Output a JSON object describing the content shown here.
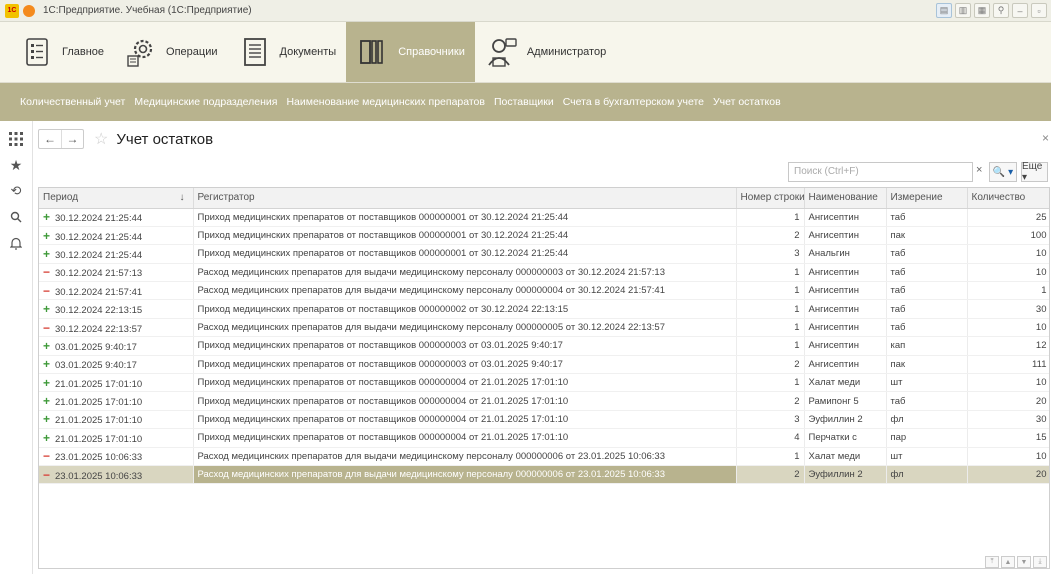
{
  "window": {
    "title": "1С:Предприятие. Учебная (1С:Предприятие)",
    "logo_text": "1С"
  },
  "sections": [
    {
      "label": "Главное",
      "icon": "main-icon"
    },
    {
      "label": "Операции",
      "icon": "operations-icon"
    },
    {
      "label": "Документы",
      "icon": "documents-icon"
    },
    {
      "label": "Справочники",
      "icon": "catalogs-icon",
      "active": true
    },
    {
      "label": "Администратор",
      "icon": "admin-icon"
    }
  ],
  "nav_items": [
    "Количественный учет",
    "Медицинские подразделения",
    "Наименование медицинских препаратов",
    "Поставщики",
    "Счета в бухгалтерском учете",
    "Учет остатков"
  ],
  "form": {
    "title": "Учет остатков",
    "search_placeholder": "Поиск (Ctrl+F)",
    "more_label": "Еще ▾",
    "search_btn_label": "🔍 ▾"
  },
  "table": {
    "columns": [
      "Период",
      "Регистратор",
      "Номер строки",
      "Наименование",
      "Измерение",
      "Количество"
    ],
    "rows": [
      {
        "sign": "+",
        "period": "30.12.2024 21:25:44",
        "registrar": "Приход медицинских препаратов от поставщиков 000000001 от 30.12.2024 21:25:44",
        "line": "1",
        "name": "Ангисептин",
        "unit": "таб",
        "qty": "25"
      },
      {
        "sign": "+",
        "period": "30.12.2024 21:25:44",
        "registrar": "Приход медицинских препаратов от поставщиков 000000001 от 30.12.2024 21:25:44",
        "line": "2",
        "name": "Ангисептин",
        "unit": "пак",
        "qty": "100"
      },
      {
        "sign": "+",
        "period": "30.12.2024 21:25:44",
        "registrar": "Приход медицинских препаратов от поставщиков 000000001 от 30.12.2024 21:25:44",
        "line": "3",
        "name": "Анальгин",
        "unit": "таб",
        "qty": "10"
      },
      {
        "sign": "−",
        "period": "30.12.2024 21:57:13",
        "registrar": "Расход медицинских препаратов для выдачи медицинскому персоналу 000000003 от 30.12.2024 21:57:13",
        "line": "1",
        "name": "Ангисептин",
        "unit": "таб",
        "qty": "10"
      },
      {
        "sign": "−",
        "period": "30.12.2024 21:57:41",
        "registrar": "Расход медицинских препаратов для выдачи медицинскому персоналу 000000004 от 30.12.2024 21:57:41",
        "line": "1",
        "name": "Ангисептин",
        "unit": "таб",
        "qty": "1"
      },
      {
        "sign": "+",
        "period": "30.12.2024 22:13:15",
        "registrar": "Приход медицинских препаратов от поставщиков 000000002 от 30.12.2024 22:13:15",
        "line": "1",
        "name": "Ангисептин",
        "unit": "таб",
        "qty": "30"
      },
      {
        "sign": "−",
        "period": "30.12.2024 22:13:57",
        "registrar": "Расход медицинских препаратов для выдачи медицинскому персоналу 000000005 от 30.12.2024 22:13:57",
        "line": "1",
        "name": "Ангисептин",
        "unit": "таб",
        "qty": "10"
      },
      {
        "sign": "+",
        "period": "03.01.2025 9:40:17",
        "registrar": "Приход медицинских препаратов от поставщиков 000000003 от 03.01.2025 9:40:17",
        "line": "1",
        "name": "Ангисептин",
        "unit": "кап",
        "qty": "12"
      },
      {
        "sign": "+",
        "period": "03.01.2025 9:40:17",
        "registrar": "Приход медицинских препаратов от поставщиков 000000003 от 03.01.2025 9:40:17",
        "line": "2",
        "name": "Ангисептин",
        "unit": "пак",
        "qty": "111"
      },
      {
        "sign": "+",
        "period": "21.01.2025 17:01:10",
        "registrar": "Приход медицинских препаратов от поставщиков 000000004 от 21.01.2025 17:01:10",
        "line": "1",
        "name": "Халат меди",
        "unit": "шт",
        "qty": "10"
      },
      {
        "sign": "+",
        "period": "21.01.2025 17:01:10",
        "registrar": "Приход медицинских препаратов от поставщиков 000000004 от 21.01.2025 17:01:10",
        "line": "2",
        "name": "Рамипонг 5",
        "unit": "таб",
        "qty": "20"
      },
      {
        "sign": "+",
        "period": "21.01.2025 17:01:10",
        "registrar": "Приход медицинских препаратов от поставщиков 000000004 от 21.01.2025 17:01:10",
        "line": "3",
        "name": "Эуфиллин 2",
        "unit": "фл",
        "qty": "30"
      },
      {
        "sign": "+",
        "period": "21.01.2025 17:01:10",
        "registrar": "Приход медицинских препаратов от поставщиков 000000004 от 21.01.2025 17:01:10",
        "line": "4",
        "name": "Перчатки с",
        "unit": "пар",
        "qty": "15"
      },
      {
        "sign": "−",
        "period": "23.01.2025 10:06:33",
        "registrar": "Расход медицинских препаратов для выдачи медицинскому персоналу 000000006 от 23.01.2025 10:06:33",
        "line": "1",
        "name": "Халат меди",
        "unit": "шт",
        "qty": "10"
      },
      {
        "sign": "−",
        "period": "23.01.2025 10:06:33",
        "registrar": "Расход медицинских препаратов для выдачи медицинскому персоналу 000000006 от 23.01.2025 10:06:33",
        "line": "2",
        "name": "Эуфиллин 2",
        "unit": "фл",
        "qty": "20",
        "selected": true
      }
    ]
  },
  "colors": {
    "accent": "#b8b38e",
    "plus": "#3f9a3a",
    "minus": "#d7433a"
  }
}
